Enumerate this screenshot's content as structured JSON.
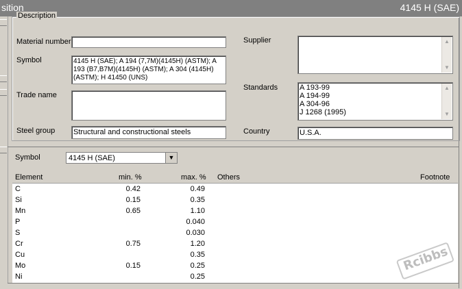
{
  "window": {
    "title_left": "sition",
    "title_right": "4145 H (SAE)"
  },
  "description": {
    "legend": "Description",
    "material_number": {
      "label": "Material number",
      "value": ""
    },
    "symbol": {
      "label": "Symbol",
      "value": "4145 H (SAE); A 194 (7,7M)(4145H) (ASTM); A 193 (B7,B7M)(4145H) (ASTM); A 304 (4145H) (ASTM); H 41450 (UNS)"
    },
    "trade_name": {
      "label": "Trade name",
      "value": ""
    },
    "steel_group": {
      "label": "Steel group",
      "value": "Structural and constructional steels"
    },
    "supplier": {
      "label": "Supplier",
      "value": ""
    },
    "standards": {
      "label": "Standards",
      "items": [
        "A 193-99",
        "A 194-99",
        "A 304-96",
        "J 1268 (1995)"
      ]
    },
    "country": {
      "label": "Country",
      "value": "U.S.A."
    }
  },
  "symbol_select": {
    "label": "Symbol",
    "value": "4145 H (SAE)"
  },
  "table": {
    "headers": {
      "element": "Element",
      "min": "min. %",
      "max": "max. %",
      "others": "Others",
      "footnote": "Footnote"
    },
    "rows": [
      {
        "element": "C",
        "min": "0.42",
        "max": "0.49"
      },
      {
        "element": "Si",
        "min": "0.15",
        "max": "0.35"
      },
      {
        "element": "Mn",
        "min": "0.65",
        "max": "1.10"
      },
      {
        "element": "P",
        "min": "",
        "max": "0.040"
      },
      {
        "element": "S",
        "min": "",
        "max": "0.030"
      },
      {
        "element": "Cr",
        "min": "0.75",
        "max": "1.20"
      },
      {
        "element": "Cu",
        "min": "",
        "max": "0.35"
      },
      {
        "element": "Mo",
        "min": "0.15",
        "max": "0.25"
      },
      {
        "element": "Ni",
        "min": "",
        "max": "0.25"
      }
    ]
  },
  "watermark": "Rcibbs"
}
